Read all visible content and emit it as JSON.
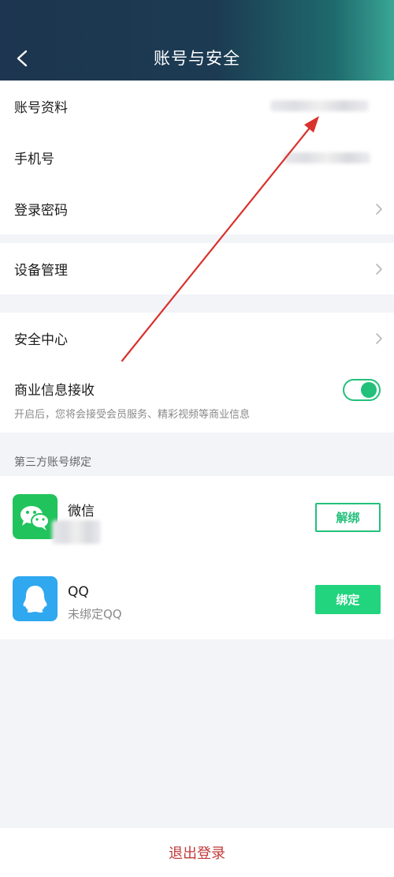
{
  "header": {
    "title": "账号与安全"
  },
  "account": {
    "profile_label": "账号资料",
    "phone_label": "手机号",
    "password_label": "登录密码"
  },
  "device": {
    "label": "设备管理"
  },
  "security": {
    "center_label": "安全中心",
    "commercial_label": "商业信息接收",
    "commercial_desc": "开启后，您将会接受会员服务、精彩视频等商业信息",
    "commercial_enabled": true
  },
  "third_party": {
    "section_label": "第三方账号绑定",
    "wechat": {
      "name": "微信",
      "button": "解绑"
    },
    "qq": {
      "name": "QQ",
      "status": "未绑定QQ",
      "button": "绑定"
    }
  },
  "logout": {
    "label": "退出登录"
  },
  "colors": {
    "accent_green": "#22c07a",
    "logout_red": "#c23a3a",
    "annotation_arrow": "#d9322c"
  },
  "icons": {
    "back": "chevron-left-icon",
    "row": "chevron-right-icon",
    "wechat": "wechat-icon",
    "qq": "qq-icon"
  }
}
